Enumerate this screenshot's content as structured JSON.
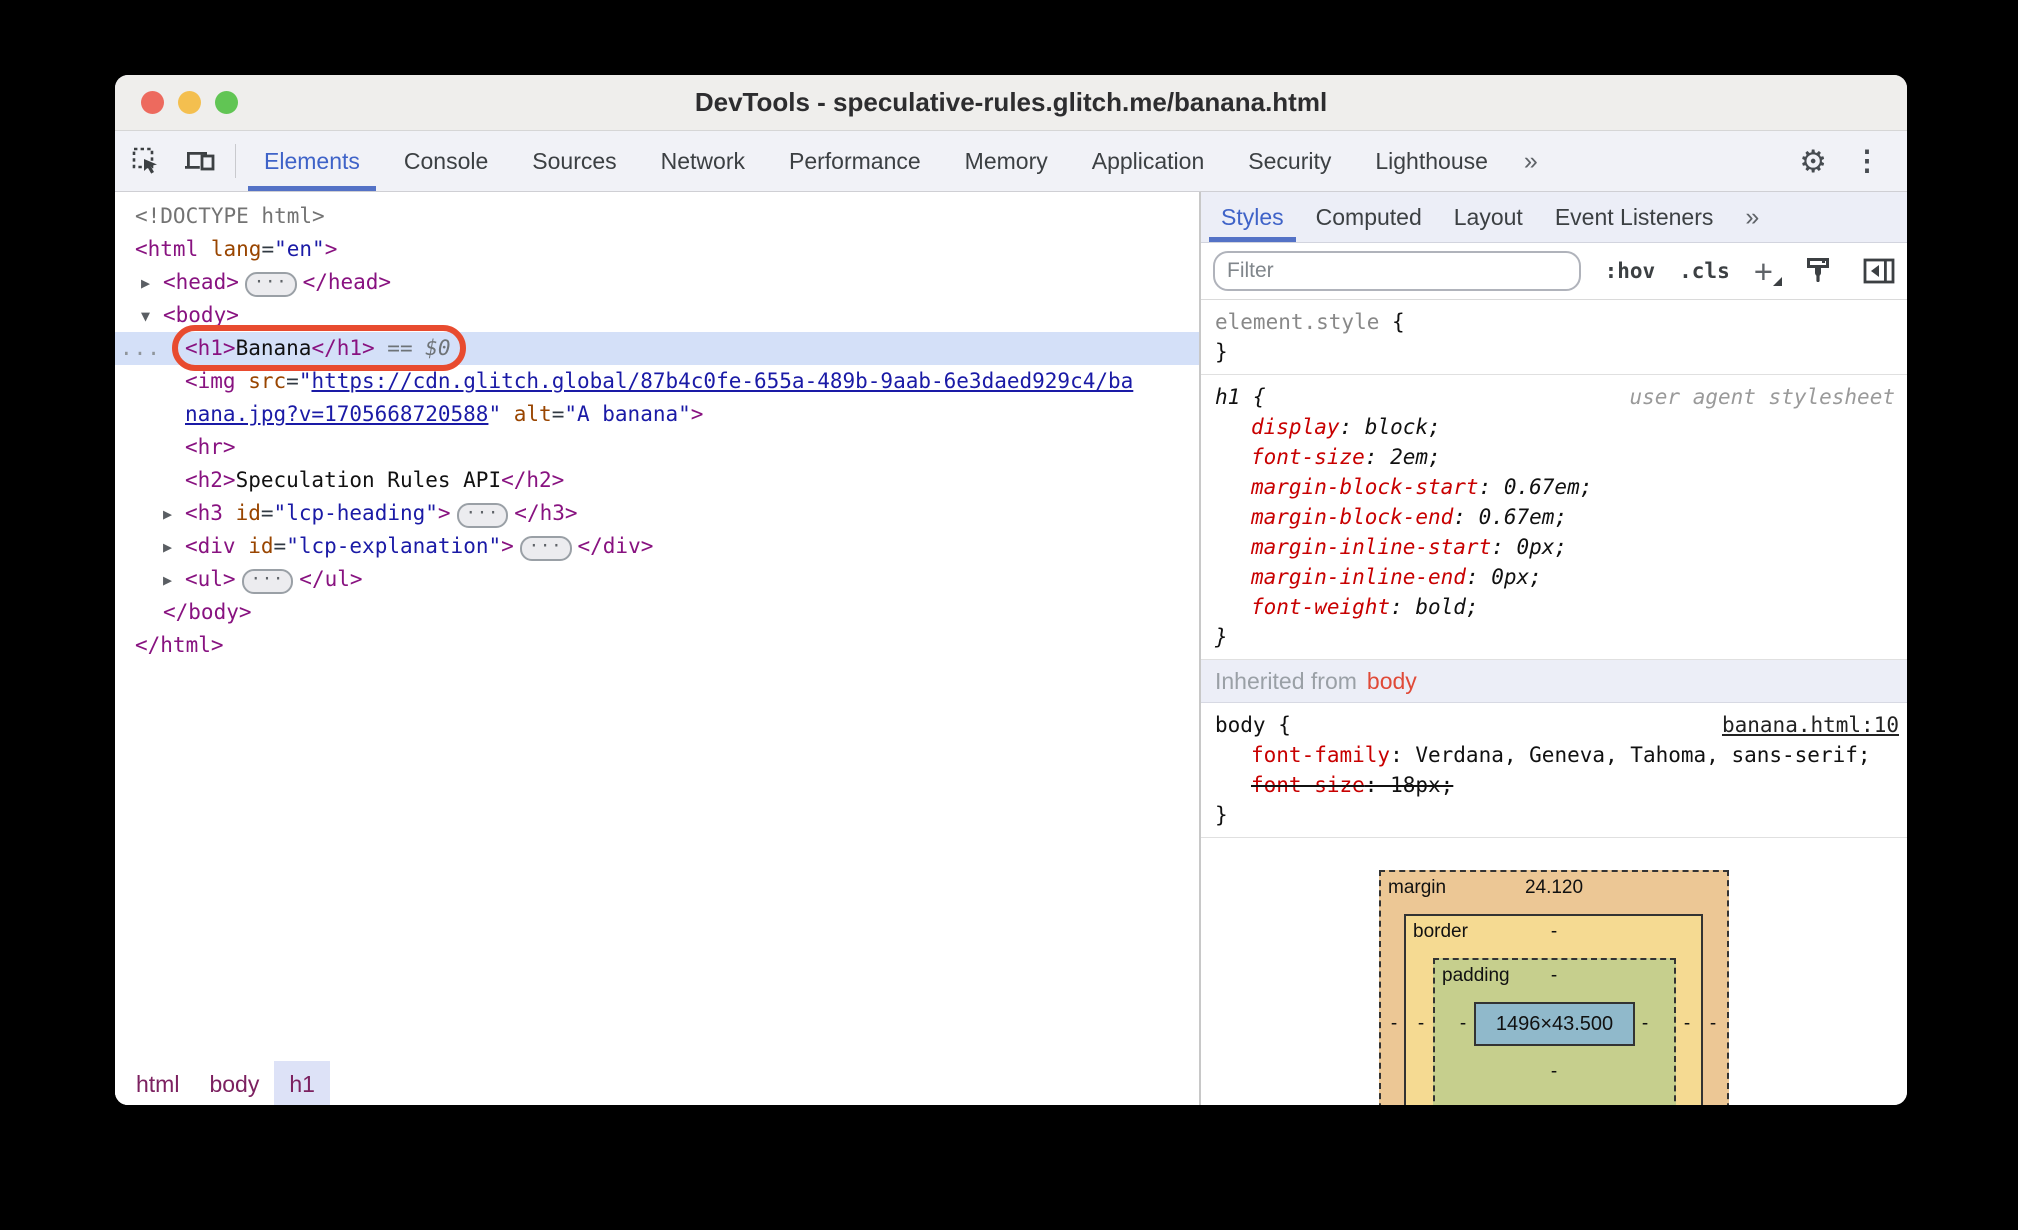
{
  "colors": {
    "accent_blue": "#3f63c8",
    "tab_underline": "#5472c6",
    "selection_bg": "#d4e0f8",
    "annotation_orange": "#e84b2f",
    "tag": "#881280",
    "attribute": "#994500",
    "value": "#1a1aa6",
    "property": "#c80000",
    "box_margin": "#ecc795",
    "box_border": "#f5da92",
    "box_padding": "#c6cf8d",
    "box_content": "#90b9cb"
  },
  "window": {
    "title": "DevTools - speculative-rules.glitch.me/banana.html"
  },
  "toolbar": {
    "icons": [
      "inspect-icon",
      "device-toolbar-icon"
    ],
    "tabs": [
      "Elements",
      "Console",
      "Sources",
      "Network",
      "Performance",
      "Memory",
      "Application",
      "Security",
      "Lighthouse"
    ],
    "selected_tab": "Elements",
    "more_tabs": "»",
    "gear": "⚙",
    "kebab": "⋮"
  },
  "dom_tree": {
    "lines": [
      {
        "indent": 0,
        "segs": [
          {
            "k": "g",
            "t": "<!DOCTYPE html>"
          }
        ]
      },
      {
        "indent": 0,
        "segs": [
          {
            "k": "t",
            "t": "<html"
          },
          {
            "k": "e",
            "t": " "
          },
          {
            "k": "a",
            "t": "lang"
          },
          {
            "k": "e",
            "t": "="
          },
          {
            "k": "v",
            "t": "\"en\""
          },
          {
            "k": "t",
            "t": ">"
          }
        ]
      },
      {
        "indent": 1,
        "arrow": "right",
        "segs": [
          {
            "k": "t",
            "t": "<head>"
          },
          {
            "pill": true
          },
          {
            "k": "t",
            "t": "</head>"
          }
        ]
      },
      {
        "indent": 1,
        "arrow": "down",
        "segs": [
          {
            "k": "t",
            "t": "<body>"
          }
        ]
      },
      {
        "indent": 2,
        "selected": true,
        "gutter": "...",
        "annotate": true,
        "segs": [
          {
            "k": "t",
            "t": "<h1>"
          },
          {
            "k": "x",
            "t": "Banana"
          },
          {
            "k": "t",
            "t": "</h1>"
          },
          {
            "k": "m",
            "t": " == $0"
          }
        ]
      },
      {
        "indent": 2,
        "segs": [
          {
            "k": "t",
            "t": "<img"
          },
          {
            "k": "e",
            "t": " "
          },
          {
            "k": "a",
            "t": "src"
          },
          {
            "k": "e",
            "t": "="
          },
          {
            "k": "v",
            "t": "\""
          },
          {
            "k": "l",
            "t": "https://cdn.glitch.global/87b4c0fe-655a-489b-9aab-6e3daed929c4/ba"
          }
        ]
      },
      {
        "indent": 2,
        "segs": [
          {
            "k": "l",
            "t": "nana.jpg?v=1705668720588"
          },
          {
            "k": "v",
            "t": "\""
          },
          {
            "k": "e",
            "t": " "
          },
          {
            "k": "a",
            "t": "alt"
          },
          {
            "k": "e",
            "t": "="
          },
          {
            "k": "v",
            "t": "\"A banana\""
          },
          {
            "k": "t",
            "t": ">"
          }
        ]
      },
      {
        "indent": 2,
        "segs": [
          {
            "k": "t",
            "t": "<hr>"
          }
        ]
      },
      {
        "indent": 2,
        "segs": [
          {
            "k": "t",
            "t": "<h2>"
          },
          {
            "k": "x",
            "t": "Speculation Rules API"
          },
          {
            "k": "t",
            "t": "</h2>"
          }
        ]
      },
      {
        "indent": 2,
        "arrow": "right",
        "segs": [
          {
            "k": "t",
            "t": "<h3"
          },
          {
            "k": "e",
            "t": " "
          },
          {
            "k": "a",
            "t": "id"
          },
          {
            "k": "e",
            "t": "="
          },
          {
            "k": "v",
            "t": "\"lcp-heading\""
          },
          {
            "k": "t",
            "t": ">"
          },
          {
            "pill": true
          },
          {
            "k": "t",
            "t": "</h3>"
          }
        ]
      },
      {
        "indent": 2,
        "arrow": "right",
        "segs": [
          {
            "k": "t",
            "t": "<div"
          },
          {
            "k": "e",
            "t": " "
          },
          {
            "k": "a",
            "t": "id"
          },
          {
            "k": "e",
            "t": "="
          },
          {
            "k": "v",
            "t": "\"lcp-explanation\""
          },
          {
            "k": "t",
            "t": ">"
          },
          {
            "pill": true
          },
          {
            "k": "t",
            "t": "</div>"
          }
        ]
      },
      {
        "indent": 2,
        "arrow": "right",
        "segs": [
          {
            "k": "t",
            "t": "<ul>"
          },
          {
            "pill": true
          },
          {
            "k": "t",
            "t": "</ul>"
          }
        ]
      },
      {
        "indent": 1,
        "segs": [
          {
            "k": "t",
            "t": "</body>"
          }
        ]
      },
      {
        "indent": 0,
        "segs": [
          {
            "k": "t",
            "t": "</html>"
          }
        ]
      }
    ]
  },
  "breadcrumb": {
    "items": [
      "html",
      "body",
      "h1"
    ],
    "selected": "h1"
  },
  "sidebar": {
    "tabs": [
      "Styles",
      "Computed",
      "Layout",
      "Event Listeners"
    ],
    "selected_tab": "Styles",
    "more_tabs": "»",
    "filter_placeholder": "Filter",
    "pseudo_toggle": ":hov",
    "class_toggle": ".cls",
    "new_rule_button": "+"
  },
  "styles_pane": {
    "element_style": {
      "selector": "element.style",
      "open": "{",
      "close": "}"
    },
    "h1_rule": {
      "selector": "h1 {",
      "origin": "user agent stylesheet",
      "close": "}",
      "declarations": [
        {
          "name": "display",
          "value": "block"
        },
        {
          "name": "font-size",
          "value": "2em"
        },
        {
          "name": "margin-block-start",
          "value": "0.67em"
        },
        {
          "name": "margin-block-end",
          "value": "0.67em"
        },
        {
          "name": "margin-inline-start",
          "value": "0px"
        },
        {
          "name": "margin-inline-end",
          "value": "0px"
        },
        {
          "name": "font-weight",
          "value": "bold"
        }
      ]
    },
    "inherited_header": {
      "prefix": "Inherited from",
      "from": "body"
    },
    "body_rule": {
      "selector": "body {",
      "source_link": "banana.html:10",
      "close": "}",
      "declarations": [
        {
          "name": "font-family",
          "value": "Verdana, Geneva, Tahoma, sans-serif"
        },
        {
          "name": "font-size",
          "value": "18px",
          "overridden": true
        }
      ]
    }
  },
  "box_model": {
    "margin_label": "margin",
    "margin_top_value": "24.120",
    "border_label": "border",
    "padding_label": "padding",
    "content_value": "1496×43.500",
    "empty_value": "-"
  }
}
